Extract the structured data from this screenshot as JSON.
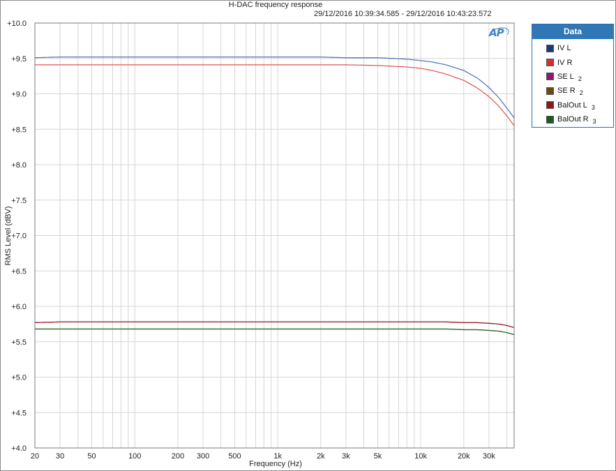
{
  "chart_data": {
    "type": "line",
    "title": "H-DAC frequency response",
    "subtitle": "29/12/2016 10:39:34.585 - 29/12/2016 10:43:23.572",
    "xlabel": "Frequency (Hz)",
    "ylabel": "RMS Level (dBV)",
    "xscale": "log",
    "xlim": [
      20,
      45000
    ],
    "ylim": [
      4.0,
      10.0
    ],
    "grid": true,
    "x_ticks": [
      20,
      30,
      50,
      100,
      200,
      300,
      500,
      1000,
      2000,
      3000,
      5000,
      10000,
      20000,
      30000
    ],
    "x_tick_labels": [
      "20",
      "30",
      "50",
      "100",
      "200",
      "300",
      "500",
      "1k",
      "2k",
      "3k",
      "5k",
      "10k",
      "20k",
      "30k"
    ],
    "y_ticks": [
      4.0,
      4.5,
      5.0,
      5.5,
      6.0,
      6.5,
      7.0,
      7.5,
      8.0,
      8.5,
      9.0,
      9.5,
      10.0
    ],
    "y_tick_labels": [
      "+4.0",
      "+4.5",
      "+5.0",
      "+5.5",
      "+6.0",
      "+6.5",
      "+7.0",
      "+7.5",
      "+8.0",
      "+8.5",
      "+9.0",
      "+9.5",
      "+10.0"
    ],
    "legend_title": "Data",
    "legend_position": "top-right",
    "series": [
      {
        "name": "IV L",
        "subscript": "",
        "color": "#4a6fb5",
        "swatch": "#1a3a7a",
        "points": [
          [
            20,
            9.51
          ],
          [
            30,
            9.52
          ],
          [
            1000,
            9.52
          ],
          [
            2000,
            9.52
          ],
          [
            3000,
            9.51
          ],
          [
            5000,
            9.51
          ],
          [
            8000,
            9.49
          ],
          [
            10000,
            9.47
          ],
          [
            12000,
            9.45
          ],
          [
            15000,
            9.41
          ],
          [
            20000,
            9.33
          ],
          [
            25000,
            9.22
          ],
          [
            30000,
            9.09
          ],
          [
            35000,
            8.95
          ],
          [
            40000,
            8.8
          ],
          [
            45000,
            8.66
          ]
        ]
      },
      {
        "name": "IV R",
        "subscript": "",
        "color": "#e05050",
        "swatch": "#d03030",
        "points": [
          [
            20,
            9.41
          ],
          [
            30,
            9.41
          ],
          [
            1000,
            9.41
          ],
          [
            2000,
            9.41
          ],
          [
            3000,
            9.41
          ],
          [
            5000,
            9.4
          ],
          [
            8000,
            9.38
          ],
          [
            10000,
            9.36
          ],
          [
            12000,
            9.33
          ],
          [
            15000,
            9.28
          ],
          [
            20000,
            9.19
          ],
          [
            25000,
            9.08
          ],
          [
            30000,
            8.96
          ],
          [
            35000,
            8.83
          ],
          [
            40000,
            8.69
          ],
          [
            45000,
            8.55
          ]
        ]
      },
      {
        "name": "SE L",
        "subscript": "2",
        "color": "#8a2a7a",
        "swatch": "#8a1a6a",
        "points": [
          [
            20,
            5.77
          ],
          [
            30,
            5.78
          ],
          [
            1000,
            5.78
          ],
          [
            10000,
            5.78
          ],
          [
            15000,
            5.78
          ],
          [
            20000,
            5.77
          ],
          [
            25000,
            5.77
          ],
          [
            30000,
            5.76
          ],
          [
            35000,
            5.75
          ],
          [
            40000,
            5.73
          ],
          [
            45000,
            5.7
          ]
        ]
      },
      {
        "name": "SE R",
        "subscript": "2",
        "color": "#6a5020",
        "swatch": "#6a4a10",
        "points": [
          [
            20,
            5.68
          ],
          [
            30,
            5.68
          ],
          [
            1000,
            5.68
          ],
          [
            10000,
            5.68
          ],
          [
            15000,
            5.68
          ],
          [
            20000,
            5.67
          ],
          [
            25000,
            5.67
          ],
          [
            30000,
            5.66
          ],
          [
            35000,
            5.65
          ],
          [
            40000,
            5.63
          ],
          [
            45000,
            5.6
          ]
        ]
      },
      {
        "name": "BalOut L",
        "subscript": "3",
        "color": "#9a2020",
        "swatch": "#8a1a1a",
        "points": [
          [
            20,
            5.77
          ],
          [
            30,
            5.78
          ],
          [
            1000,
            5.78
          ],
          [
            10000,
            5.78
          ],
          [
            15000,
            5.78
          ],
          [
            20000,
            5.77
          ],
          [
            25000,
            5.77
          ],
          [
            30000,
            5.76
          ],
          [
            35000,
            5.75
          ],
          [
            40000,
            5.73
          ],
          [
            45000,
            5.7
          ]
        ]
      },
      {
        "name": "BalOut R",
        "subscript": "3",
        "color": "#2a6a2a",
        "swatch": "#1a5a1a",
        "points": [
          [
            20,
            5.68
          ],
          [
            30,
            5.68
          ],
          [
            1000,
            5.68
          ],
          [
            10000,
            5.68
          ],
          [
            15000,
            5.68
          ],
          [
            20000,
            5.67
          ],
          [
            25000,
            5.67
          ],
          [
            30000,
            5.66
          ],
          [
            35000,
            5.65
          ],
          [
            40000,
            5.63
          ],
          [
            45000,
            5.6
          ]
        ]
      }
    ]
  }
}
